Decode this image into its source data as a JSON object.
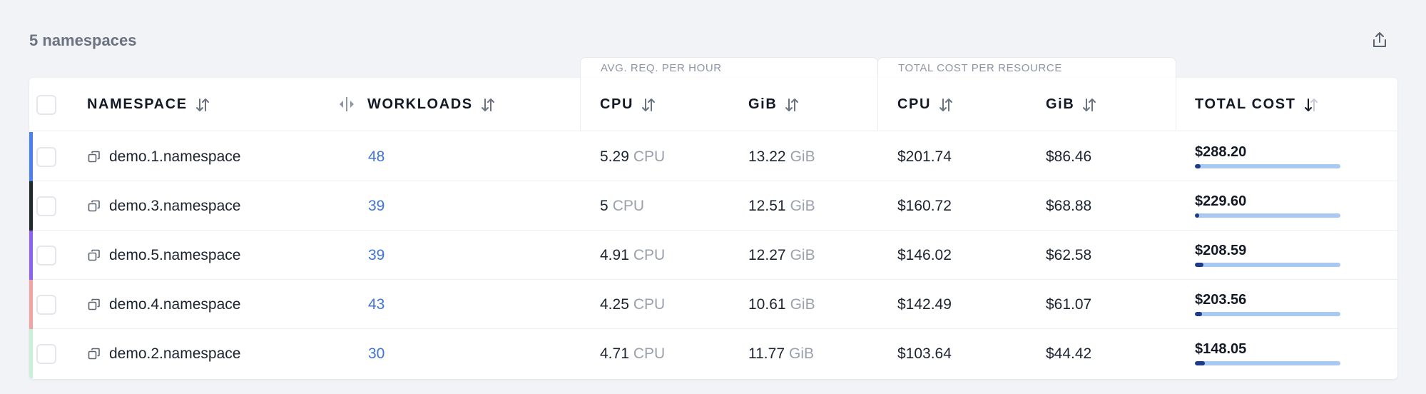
{
  "title": "5 namespaces",
  "toolbar": {
    "export_icon": "share-upload-icon"
  },
  "groups": {
    "avg_req": "AVG. REQ. PER HOUR",
    "total_cost": "TOTAL COST PER RESOURCE"
  },
  "columns": {
    "namespace": "NAMESPACE",
    "workloads": "WORKLOADS",
    "cpu_req": "CPU",
    "gib_req": "GiB",
    "cpu_cost": "CPU",
    "gib_cost": "GiB",
    "total_cost": "TOTAL COST"
  },
  "colors": {
    "accent_link": "#3f74d6",
    "bar_track": "#a9c8f2",
    "bar_fill": "#1e3a8a"
  },
  "rows": [
    {
      "stripe_color": "#4a7ff0",
      "namespace": "demo.1.namespace",
      "workloads": "48",
      "cpu": "5.29",
      "cpu_unit": "CPU",
      "gib": "13.22",
      "gib_unit": "GiB",
      "cpu_cost": "$201.74",
      "gib_cost": "$86.46",
      "total": "$288.20",
      "share_percent": 4
    },
    {
      "stripe_color": "#1f2a2a",
      "namespace": "demo.3.namespace",
      "workloads": "39",
      "cpu": "5",
      "cpu_unit": "CPU",
      "gib": "12.51",
      "gib_unit": "GiB",
      "cpu_cost": "$160.72",
      "gib_cost": "$68.88",
      "total": "$229.60",
      "share_percent": 3
    },
    {
      "stripe_color": "#8b63f0",
      "namespace": "demo.5.namespace",
      "workloads": "39",
      "cpu": "4.91",
      "cpu_unit": "CPU",
      "gib": "12.27",
      "gib_unit": "GiB",
      "cpu_cost": "$146.02",
      "gib_cost": "$62.58",
      "total": "$208.59",
      "share_percent": 6
    },
    {
      "stripe_color": "#f0a3a3",
      "namespace": "demo.4.namespace",
      "workloads": "43",
      "cpu": "4.25",
      "cpu_unit": "CPU",
      "gib": "10.61",
      "gib_unit": "GiB",
      "cpu_cost": "$142.49",
      "gib_cost": "$61.07",
      "total": "$203.56",
      "share_percent": 5
    },
    {
      "stripe_color": "#c9efd6",
      "namespace": "demo.2.namespace",
      "workloads": "30",
      "cpu": "4.71",
      "cpu_unit": "CPU",
      "gib": "11.77",
      "gib_unit": "GiB",
      "cpu_cost": "$103.64",
      "gib_cost": "$44.42",
      "total": "$148.05",
      "share_percent": 7
    }
  ]
}
